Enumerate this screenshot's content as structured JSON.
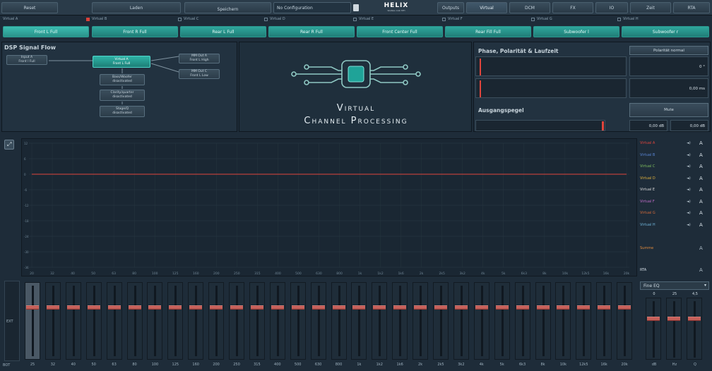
{
  "topbar": {
    "reset": "Reset",
    "load": "Laden",
    "save": "Speichern",
    "config": "No Configuration",
    "brand": "HELIX",
    "brand_sub": "SIGNAL CAR HIFI",
    "outputs": "Outputs",
    "virtual": "Virtual",
    "dcm": "DCM",
    "fx": "FX",
    "io": "IO",
    "time": "Zeit",
    "rta": "RTA"
  },
  "virtual_labels": [
    "Virtual A",
    "Virtual B",
    "Virtual C",
    "Virtual D",
    "Virtual E",
    "Virtual F",
    "Virtual G",
    "Virtual H"
  ],
  "virtual_buttons": [
    "Front L Full",
    "Front R Full",
    "Rear L Full",
    "Rear R Full",
    "Front Center Full",
    "Rear Fill Full",
    "Subwoofer l",
    "Subwoofer r"
  ],
  "dsp": {
    "title": "DSP Signal Flow",
    "input": [
      "Input A",
      "Front l Full"
    ],
    "virtual": [
      "Virtual A",
      "Front L Full"
    ],
    "boxes": [
      [
        "Bass/Woofer",
        "disactivated"
      ],
      [
        "Clarity/quarter",
        "disactivated"
      ],
      [
        "Stage/Q",
        "disactivated"
      ]
    ],
    "outs": [
      [
        "MM Out A",
        "Front L High"
      ],
      [
        "MM Out C",
        "Front L Low"
      ]
    ]
  },
  "center": {
    "title_line1": "Virtual",
    "title_line2": "Channel Processing"
  },
  "phase": {
    "title": "Phase, Polarität & Laufzeit",
    "polarity": "Polarität normal",
    "phase_val": "0 °",
    "delay_val": "0,00 ms",
    "level_title": "Ausgangspegel",
    "mute": "Mute",
    "level_val1": "0,00 dB",
    "level_val2": "0,00 dB"
  },
  "graph": {
    "ylabels": [
      "12",
      "6",
      "0",
      "-6",
      "-12",
      "-18",
      "-24",
      "-30",
      "-36"
    ],
    "xlabels": [
      "20",
      "32",
      "40",
      "50",
      "63",
      "80",
      "100",
      "125",
      "160",
      "200",
      "250",
      "315",
      "400",
      "500",
      "630",
      "800",
      "1k",
      "1k2",
      "1k6",
      "2k",
      "2k5",
      "3k2",
      "4k",
      "5k",
      "6k3",
      "8k",
      "10k",
      "12k5",
      "16k",
      "20k"
    ],
    "legend": [
      {
        "name": "Virtual A",
        "color": "#e0453c"
      },
      {
        "name": "Virtual B",
        "color": "#5a86d6"
      },
      {
        "name": "Virtual C",
        "color": "#7fbf5e"
      },
      {
        "name": "Virtual D",
        "color": "#e0b23c"
      },
      {
        "name": "Virtual E",
        "color": "#d9d9d9"
      },
      {
        "name": "Virtual F",
        "color": "#c06cc9"
      },
      {
        "name": "Virtual G",
        "color": "#d36a3a"
      },
      {
        "name": "Virtual H",
        "color": "#6fb3d8"
      }
    ],
    "summe": "Summe",
    "rta": "RTA",
    "mute_glyph": "◄)",
    "a_glyph": "A"
  },
  "eq": {
    "left_label": "EXT",
    "bottom_left": "BOT",
    "freqs": [
      "25",
      "32",
      "40",
      "50",
      "63",
      "80",
      "100",
      "125",
      "160",
      "200",
      "250",
      "315",
      "400",
      "500",
      "630",
      "800",
      "1k",
      "1k2",
      "1k6",
      "2k",
      "2k5",
      "3k2",
      "4k",
      "5k",
      "6k3",
      "8k",
      "10k",
      "12k5",
      "16k",
      "20k"
    ],
    "fine_eq": "Fine EQ",
    "fine_vals": [
      "0",
      "25",
      "4,5"
    ],
    "fine_labels": [
      "dB",
      "Hz",
      "Q"
    ]
  }
}
